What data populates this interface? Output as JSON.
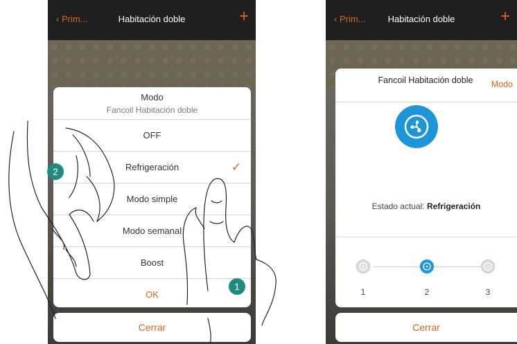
{
  "left_screen": {
    "header": {
      "back_label": "Prim...",
      "title": "Habitación doble",
      "add_icon": "plus-icon"
    },
    "menu": {
      "title": "Modo",
      "subtitle": "Fancoil Habitación doble",
      "items": [
        {
          "label": "OFF",
          "selected": false
        },
        {
          "label": "Refrigeración",
          "selected": true
        },
        {
          "label": "Modo simple",
          "selected": false
        },
        {
          "label": "Modo semanal",
          "selected": false
        },
        {
          "label": "Boost",
          "selected": false
        }
      ],
      "check_glyph": "✓",
      "ok_label": "OK"
    },
    "close_label": "Cerrar"
  },
  "right_screen": {
    "header": {
      "back_label": "Prim...",
      "title": "Habitación doble",
      "add_icon": "plus-icon"
    },
    "panel": {
      "title": "Fancoil Habitación doble",
      "mode_label": "Modo",
      "fan_icon": "fan-icon",
      "status_prefix": "Estado actual:",
      "status_value": "Refrigeración",
      "speeds": [
        "1",
        "2",
        "3"
      ],
      "active_speed": "2"
    },
    "close_label": "Cerrar"
  },
  "callouts": {
    "badge_1": "1",
    "badge_2": "2"
  },
  "colors": {
    "accent": "#d9661e",
    "fan_blue": "#1d96d8",
    "badge_teal": "#1e8a80"
  }
}
